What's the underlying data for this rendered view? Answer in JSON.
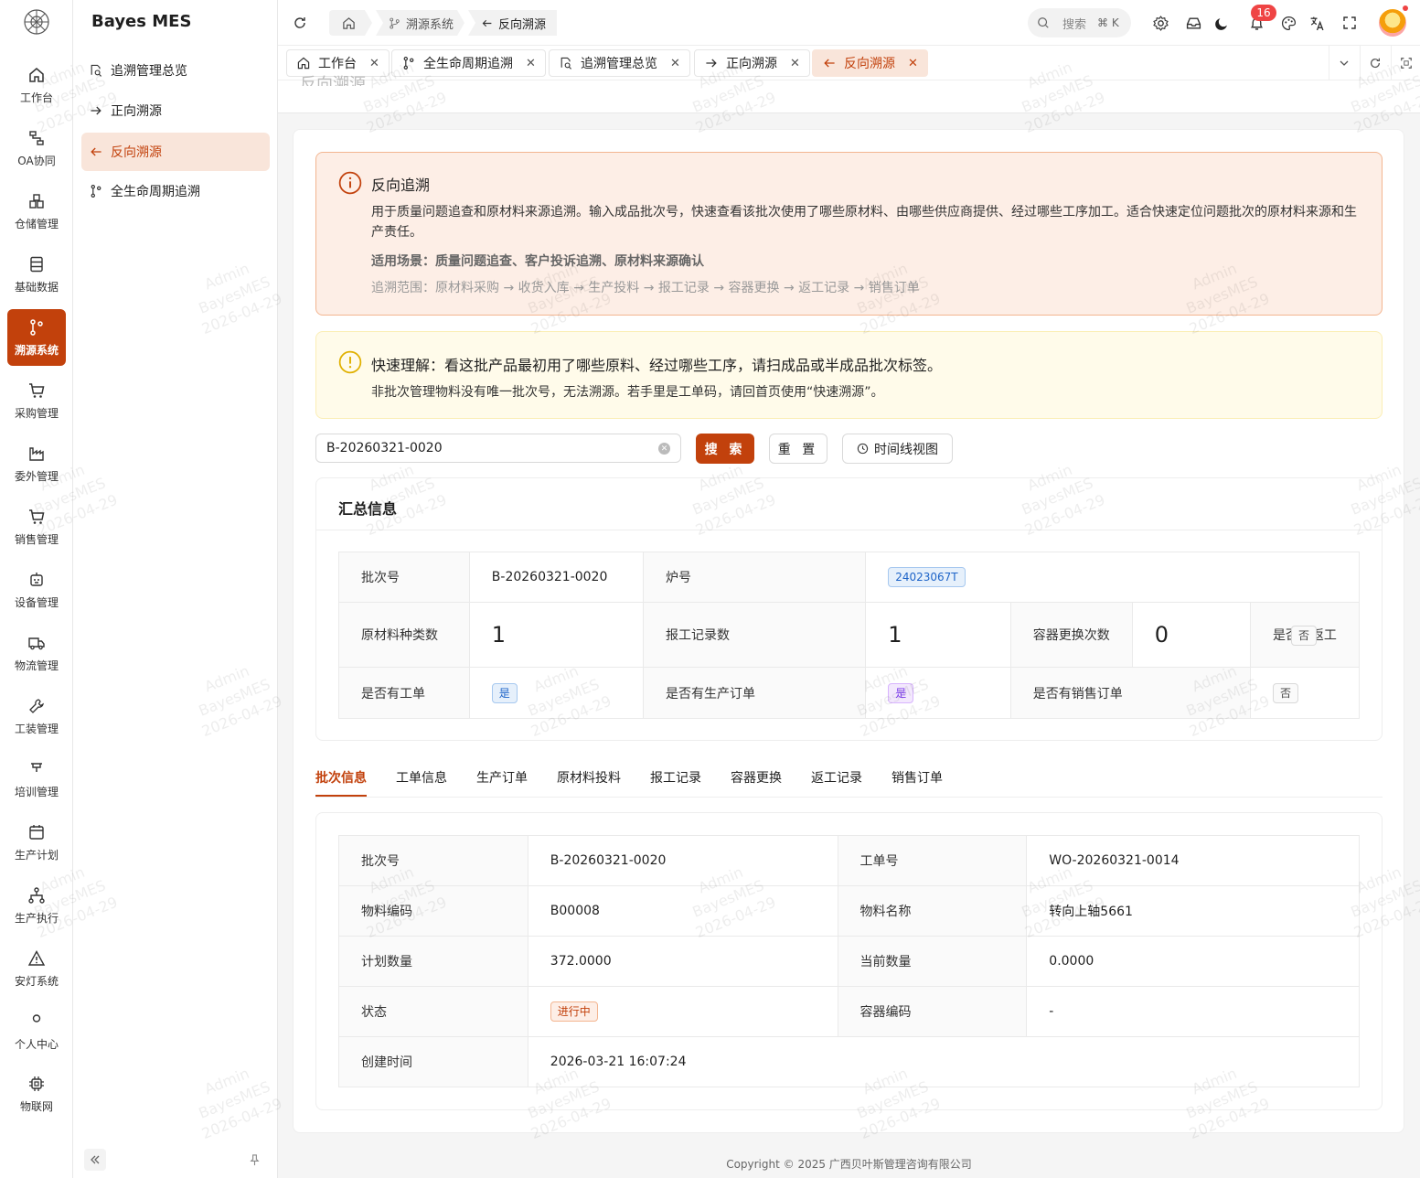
{
  "app": {
    "brand": "Bayes MES"
  },
  "rail": [
    {
      "label": "工作台",
      "icon": "home-icon"
    },
    {
      "label": "OA协同",
      "icon": "workflow-icon"
    },
    {
      "label": "仓储管理",
      "icon": "warehouse-icon"
    },
    {
      "label": "基础数据",
      "icon": "database-icon"
    },
    {
      "label": "溯源系统",
      "icon": "git-branch-icon"
    },
    {
      "label": "采购管理",
      "icon": "cart-icon"
    },
    {
      "label": "委外管理",
      "icon": "factory-icon"
    },
    {
      "label": "销售管理",
      "icon": "cart-icon"
    },
    {
      "label": "设备管理",
      "icon": "device-icon"
    },
    {
      "label": "物流管理",
      "icon": "truck-icon"
    },
    {
      "label": "工装管理",
      "icon": "wrench-icon"
    },
    {
      "label": "培训管理",
      "icon": "training-icon"
    },
    {
      "label": "生产计划",
      "icon": "calendar-icon"
    },
    {
      "label": "生产执行",
      "icon": "network-icon"
    },
    {
      "label": "安灯系统",
      "icon": "warning-icon"
    },
    {
      "label": "个人中心",
      "icon": "user-icon"
    },
    {
      "label": "物联网",
      "icon": "chip-icon"
    }
  ],
  "sidebar": {
    "items": [
      {
        "label": "追溯管理总览",
        "icon": "search-doc-icon"
      },
      {
        "label": "正向溯源",
        "icon": "arrow-right-icon"
      },
      {
        "label": "反向溯源",
        "icon": "arrow-left-icon"
      },
      {
        "label": "全生命周期追溯",
        "icon": "git-branch-icon"
      }
    ]
  },
  "header": {
    "breadcrumb": [
      "溯源系统",
      "反向溯源"
    ],
    "search_placeholder": "搜索",
    "search_kbd": "⌘ K",
    "notifications": "16"
  },
  "tabs": [
    {
      "label": "工作台",
      "icon": "home-icon"
    },
    {
      "label": "全生命周期追溯",
      "icon": "git-branch-icon"
    },
    {
      "label": "追溯管理总览",
      "icon": "search-doc-icon"
    },
    {
      "label": "正向溯源",
      "icon": "arrow-right-icon"
    },
    {
      "label": "反向溯源",
      "icon": "arrow-left-icon"
    }
  ],
  "page": {
    "ghost_title": "反向溯源"
  },
  "info_alert": {
    "title": "反向追溯",
    "desc": "用于质量问题追查和原材料来源追溯。输入成品批次号，快速查看该批次使用了哪些原材料、由哪些供应商提供、经过哪些工序加工。适合快速定位问题批次的原材料来源和生产责任。",
    "scene": "适用场景：质量问题追查、客户投诉追溯、原材料来源确认",
    "range": "追溯范围：原材料采购 → 收货入库 → 生产投料 → 报工记录 → 容器更换 → 返工记录 → 销售订单"
  },
  "warn_alert": {
    "title": "快速理解：看这批产品最初用了哪些原料、经过哪些工序，请扫成品或半成品批次标签。",
    "desc": "非批次管理物料没有唯一批次号，无法溯源。若手里是工单码，请回首页使用“快速溯源”。"
  },
  "search": {
    "value": "B-20260321-0020",
    "search_btn": "搜 索",
    "reset_btn": "重 置",
    "timeline_btn": "时间线视图"
  },
  "summary": {
    "title": "汇总信息",
    "batch_label": "批次号",
    "batch_value": "B-20260321-0020",
    "furnace_label": "炉号",
    "furnace_value": "24023067T",
    "material_types_label": "原材料种类数",
    "material_types_value": "1",
    "report_count_label": "报工记录数",
    "report_count_value": "1",
    "container_change_label": "容器更换次数",
    "container_change_value": "0",
    "rework_label": "是否有返工",
    "rework_value": "否",
    "work_order_label": "是否有工单",
    "work_order_value": "是",
    "prod_order_label": "是否有生产订单",
    "prod_order_value": "是",
    "sales_order_label": "是否有销售订单",
    "sales_order_value": "否"
  },
  "detail_tabs": [
    "批次信息",
    "工单信息",
    "生产订单",
    "原材料投料",
    "报工记录",
    "容器更换",
    "返工记录",
    "销售订单"
  ],
  "batch": {
    "batch_label": "批次号",
    "batch_value": "B-20260321-0020",
    "wo_label": "工单号",
    "wo_value": "WO-20260321-0014",
    "mat_code_label": "物料编码",
    "mat_code_value": "B00008",
    "mat_name_label": "物料名称",
    "mat_name_value": "转向上轴5661",
    "plan_qty_label": "计划数量",
    "plan_qty_value": "372.0000",
    "cur_qty_label": "当前数量",
    "cur_qty_value": "0.0000",
    "status_label": "状态",
    "status_value": "进行中",
    "container_label": "容器编码",
    "container_value": "-",
    "created_label": "创建时间",
    "created_value": "2026-03-21 16:07:24"
  },
  "watermark": {
    "user": "Admin",
    "app": "BayesMES",
    "date": "2026-04-29"
  },
  "footer": "Copyright © 2025 广西贝叶斯管理咨询有限公司",
  "colors": {
    "primary": "#c2410c",
    "primary_light": "#f9e5da",
    "info_bg": "#fdeee6",
    "warn_bg": "#fffbea"
  }
}
